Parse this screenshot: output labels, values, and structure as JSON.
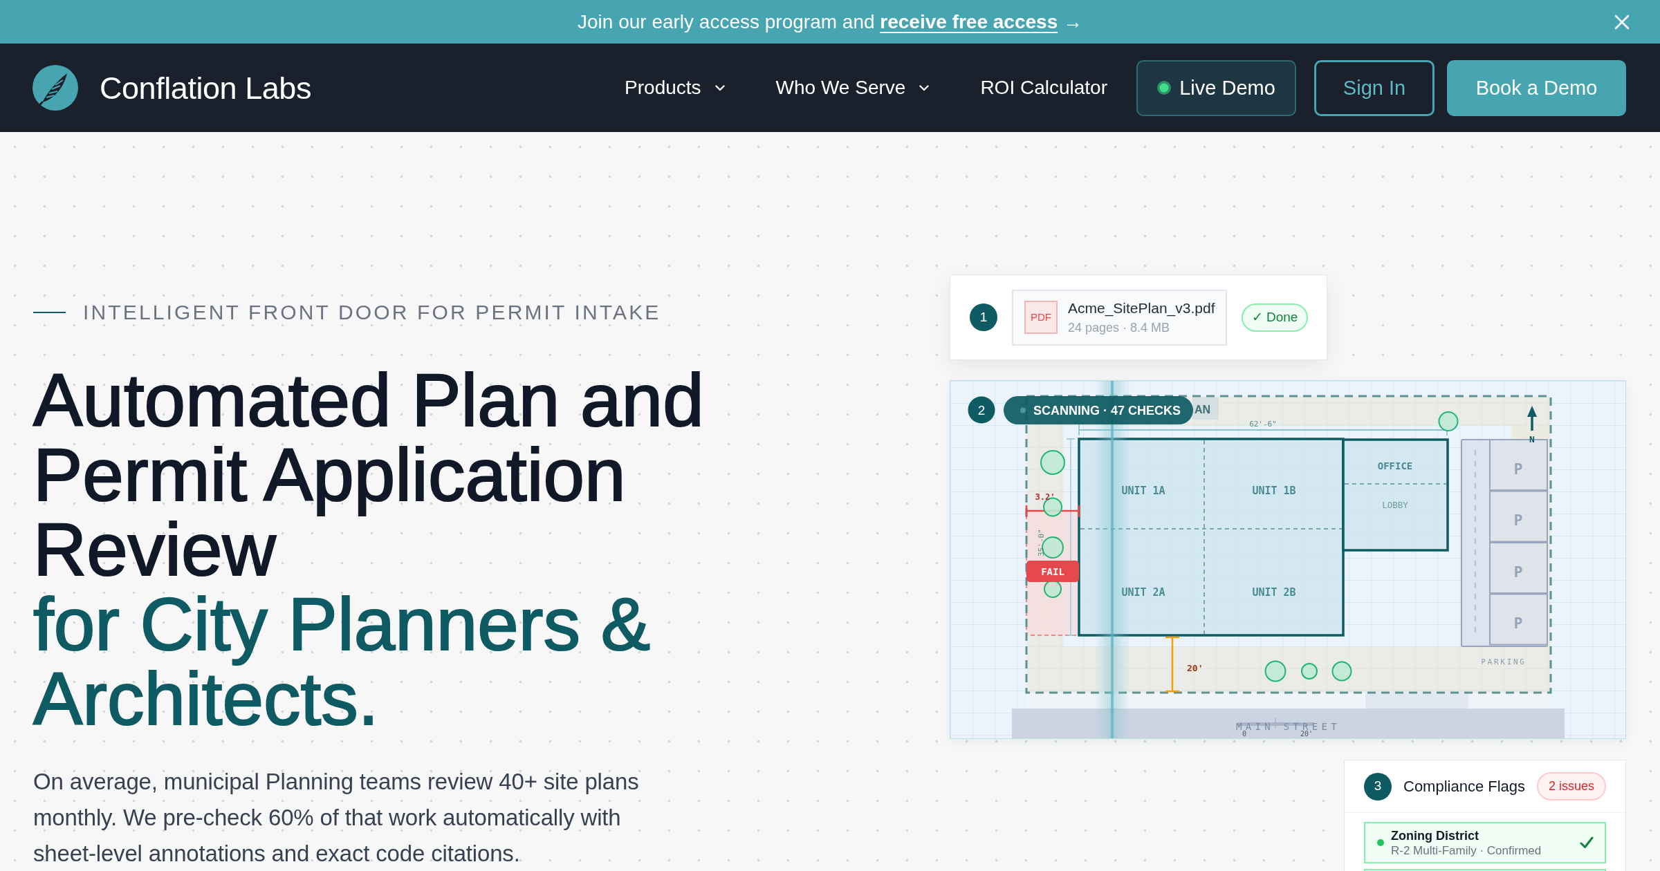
{
  "announcement": {
    "text": "Join our early access program and",
    "link": "receive free access",
    "arrow": "→"
  },
  "nav": {
    "brand": "Conflation Labs",
    "links": [
      {
        "label": "Products",
        "dropdown": true
      },
      {
        "label": "Who We Serve",
        "dropdown": true
      },
      {
        "label": "ROI Calculator",
        "dropdown": false
      }
    ],
    "buttons": [
      {
        "label": "Live Demo",
        "kind": "live"
      },
      {
        "label": "Sign In",
        "kind": "outline"
      },
      {
        "label": "Book a Demo",
        "kind": "primary"
      }
    ]
  },
  "hero": {
    "eyebrow": "INTELLIGENT FRONT DOOR FOR PERMIT INTAKE",
    "title": "Automated Plan and Permit Application Review",
    "title_accent": "for City Planners & Architects.",
    "body": "On average, municipal Planning teams review 40+ site plans monthly. We pre-check 60% of that work automatically with sheet-level annotations and exact code citations."
  },
  "upload_card": {
    "step": "1",
    "file": {
      "type": "PDF",
      "name": "Acme_SitePlan_v3.pdf",
      "meta": "24 pages · 8.4 MB"
    },
    "status": {
      "label": "✓ Done",
      "kind": "success"
    }
  },
  "site_plan": {
    "step": "2",
    "scan_badge": "SCANNING · 47 CHECKS",
    "sheet_label": "AN",
    "units": [
      "UNIT 1A",
      "UNIT 1B",
      "UNIT 2A",
      "UNIT 2B"
    ],
    "office": "OFFICE",
    "lobby": "LOBBY",
    "parking_stalls": [
      "P",
      "P",
      "P",
      "P"
    ],
    "parking_label": "PARKING",
    "north": "N",
    "width_dimension": "62'-6\"",
    "depth_dimension": "35'-0\"",
    "side_setback": "3.2'",
    "setback_status": "FAIL",
    "front_setback": "20'",
    "street": "MAIN STREET",
    "scale": [
      "0",
      "20'"
    ]
  },
  "compliance": {
    "step": "3",
    "title": "Compliance Flags",
    "badge": "2 issues",
    "items": [
      {
        "title": "Zoning District",
        "detail": "R-2 Multi-Family · Confirmed",
        "kind": "pass"
      }
    ]
  }
}
